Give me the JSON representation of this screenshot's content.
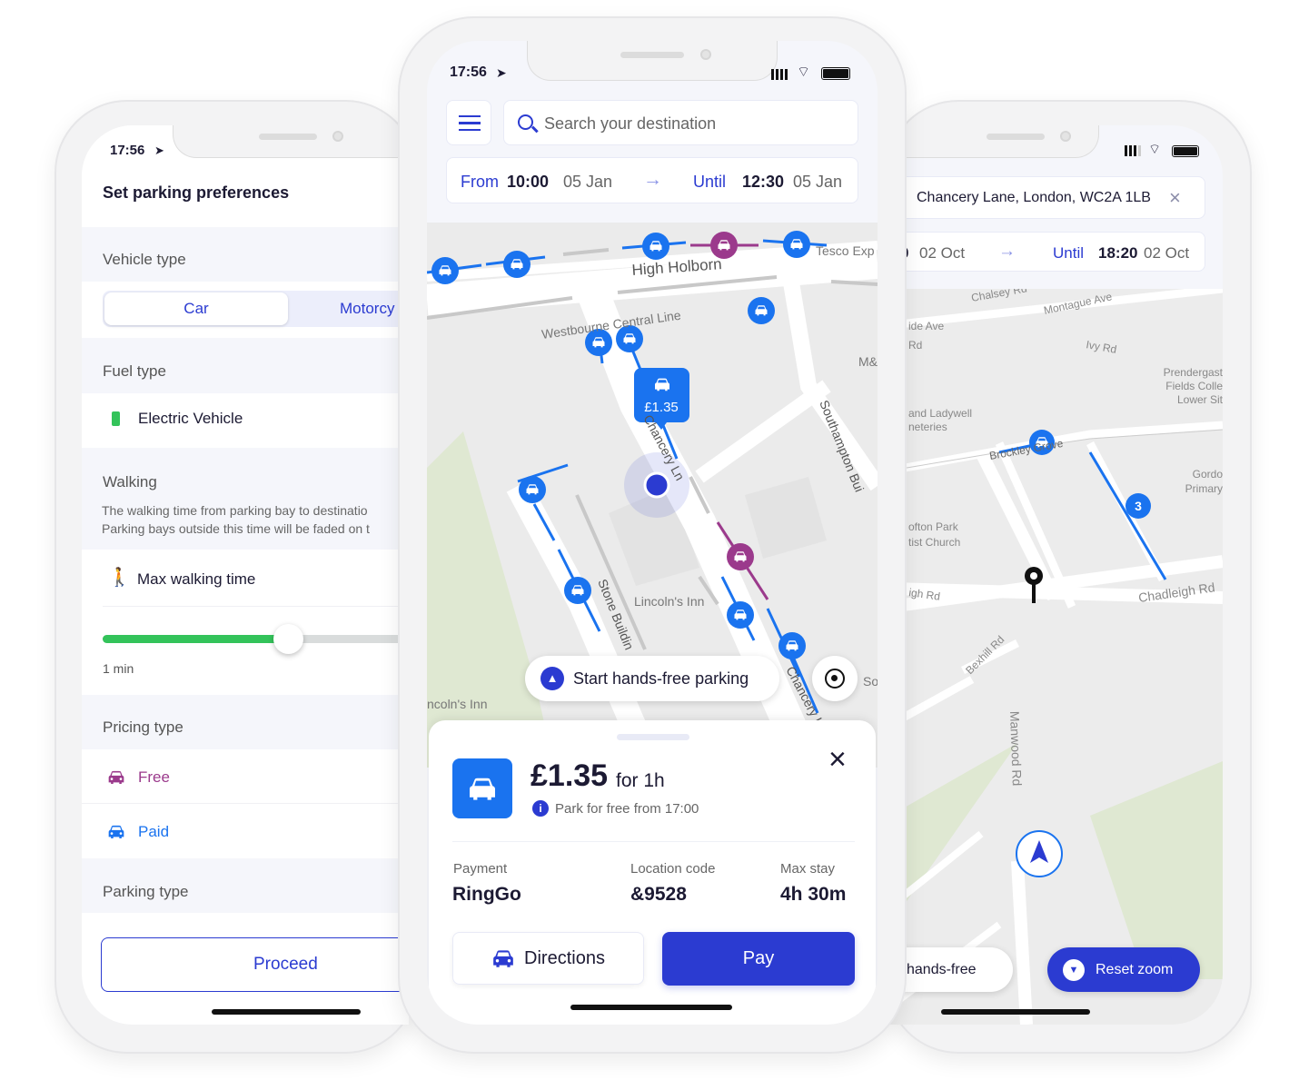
{
  "left_phone": {
    "status_time": "17:56",
    "header_title": "Set parking preferences",
    "vehicle_type": {
      "label": "Vehicle type",
      "options": [
        "Car",
        "Motorcy"
      ],
      "selected": "Car"
    },
    "fuel_type": {
      "label": "Fuel type",
      "option": "Electric Vehicle"
    },
    "walking": {
      "label": "Walking",
      "description_line1": "The walking time from parking bay to destinatio",
      "description_line2": "Parking bays outside this time will be faded on t",
      "max_label": "Max walking time",
      "slider_value_label": "1 min",
      "slider_fraction": 0.6
    },
    "pricing_type": {
      "label": "Pricing type",
      "options": [
        "Free",
        "Paid"
      ]
    },
    "parking_type": {
      "label": "Parking type"
    },
    "proceed_label": "Proceed"
  },
  "middle_phone": {
    "status_time": "17:56",
    "search_placeholder": "Search your destination",
    "time": {
      "from_label": "From",
      "from_time": "10:00",
      "from_date": "05 Jan",
      "until_label": "Until",
      "until_time": "12:30",
      "until_date": "05 Jan"
    },
    "map_labels": [
      "High Holborn",
      "Tesco Exp",
      "Westbourne Central Line",
      "M&",
      "Southampton Bui",
      "Chancery Ln",
      "Stone Buildin",
      "Lincoln's Inn",
      "ncoln's Inn",
      "Chancery L",
      "So"
    ],
    "price_pin": "£1.35",
    "start_handsfree_label": "Start hands-free parking",
    "sheet": {
      "price": "£1.35",
      "duration": "for 1h",
      "info": "Park for free from 17:00",
      "payment_label": "Payment",
      "payment_value": "RingGo",
      "location_label": "Location code",
      "location_value": "&9528",
      "maxstay_label": "Max stay",
      "maxstay_value": "4h 30m",
      "directions_label": "Directions",
      "pay_label": "Pay"
    }
  },
  "right_phone": {
    "address": "Chancery Lane, London, WC2A 1LB",
    "time": {
      "from_time_partial": "0",
      "from_date": "02 Oct",
      "until_label": "Until",
      "until_time": "18:20",
      "until_date": "02 Oct"
    },
    "map_labels": [
      "Chalsey Rd",
      "Montague Ave",
      "ide Ave",
      "Rd",
      "Ivy Rd",
      "Prendergast",
      "Fields Colle",
      "Lower Sit",
      "and Ladywell",
      "neteries",
      "Brockley Grove",
      "Gordo",
      "Primary",
      "ofton Park",
      "tist Church",
      "igh Rd",
      "Chadleigh Rd",
      "Bexhill Rd",
      "Manwood Rd",
      "3"
    ],
    "handsfree_label": "hands-free",
    "reset_zoom_label": "Reset zoom"
  },
  "colors": {
    "primary": "#2b3bd1",
    "marker_blue": "#1a73ef",
    "marker_purple": "#9b3a8c",
    "ev_green": "#33c35a"
  }
}
